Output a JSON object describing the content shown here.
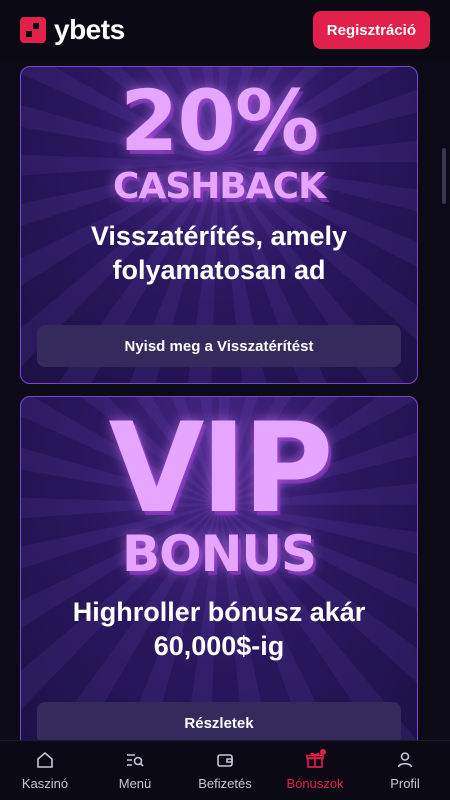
{
  "header": {
    "logo_text": "ybets",
    "register_label": "Regisztráció"
  },
  "cards": [
    {
      "headline_1": "20%",
      "headline_2": "CASHBACK",
      "subtitle": "Visszatérítés, amely folyamatosan ad",
      "button_label": "Nyisd meg a Visszatérítést"
    },
    {
      "headline_1": "VIP",
      "headline_2": "BONUS",
      "subtitle": "Highroller bónusz akár 60,000$-ig",
      "button_label": "Részletek"
    }
  ],
  "nav": {
    "items": [
      {
        "label": "Kaszinó",
        "icon": "home-icon"
      },
      {
        "label": "Menü",
        "icon": "menu-search-icon"
      },
      {
        "label": "Befizetés",
        "icon": "wallet-icon"
      },
      {
        "label": "Bónuszok",
        "icon": "gift-icon"
      },
      {
        "label": "Profil",
        "icon": "user-icon"
      }
    ],
    "active": "Bónuszok"
  },
  "colors": {
    "accent": "#e1204b",
    "card_border": "#7b45d6",
    "background": "#0d0a17"
  }
}
